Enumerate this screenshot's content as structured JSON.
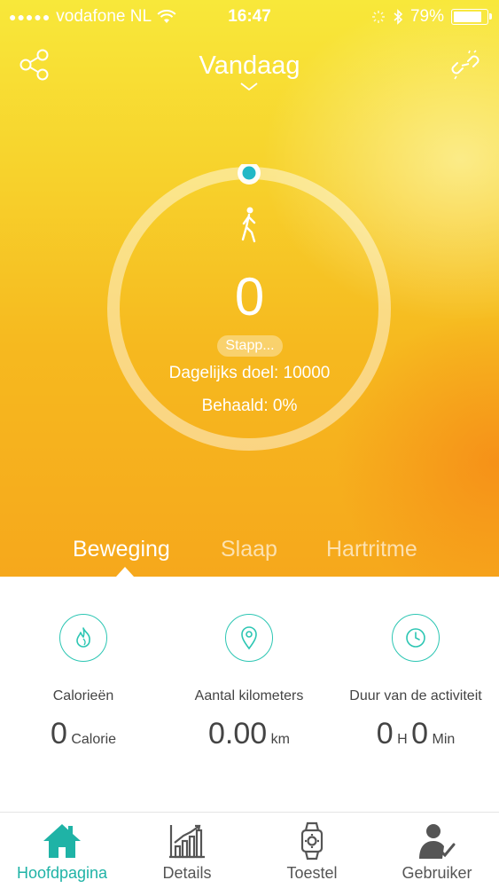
{
  "status_bar": {
    "carrier": "vodafone NL",
    "time": "16:47",
    "battery": "79%",
    "battery_level": 0.79
  },
  "header": {
    "title": "Vandaag"
  },
  "activity": {
    "steps": "0",
    "steps_label": "Stapp...",
    "daily_goal": "Dagelijks doel: 10000",
    "achieved": "Behaald: 0%",
    "progress": 0
  },
  "tabs": [
    {
      "label": "Beweging",
      "active": true
    },
    {
      "label": "Slaap",
      "active": false
    },
    {
      "label": "Hartritme",
      "active": false
    }
  ],
  "stats": [
    {
      "icon": "flame-icon",
      "label": "Calorieën",
      "value": "0",
      "unit": "Calorie"
    },
    {
      "icon": "location-pin-icon",
      "label": "Aantal kilometers",
      "value": "0.00",
      "unit": "km"
    },
    {
      "icon": "clock-icon",
      "label": "Duur van de activiteit",
      "value_h": "0",
      "unit_h": "H",
      "value_m": "0",
      "unit_m": "Min"
    }
  ],
  "tabbar": [
    {
      "label": "Hoofdpagina",
      "icon": "home-icon",
      "active": true
    },
    {
      "label": "Details",
      "icon": "chart-icon",
      "active": false
    },
    {
      "label": "Toestel",
      "icon": "watch-icon",
      "active": false
    },
    {
      "label": "Gebruiker",
      "icon": "user-check-icon",
      "active": false
    }
  ],
  "colors": {
    "accent": "#2cc6b3",
    "active_tab": "#1fb3a6",
    "gradient_top": "#f8e83a",
    "gradient_bottom": "#f6a81c"
  }
}
